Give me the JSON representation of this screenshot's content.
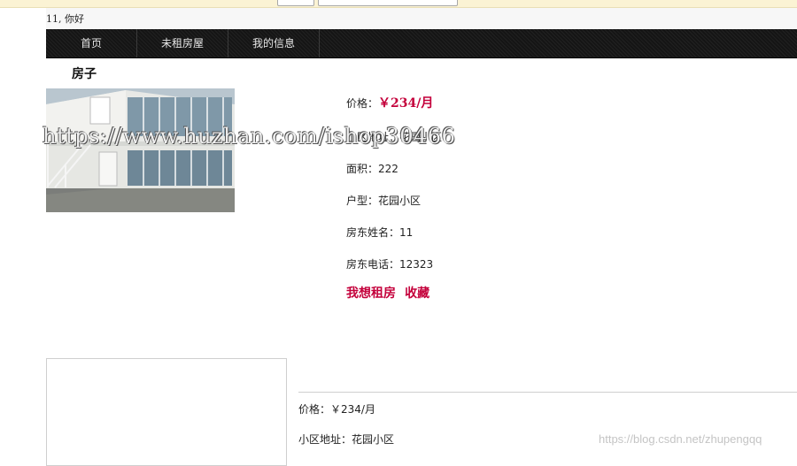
{
  "user": {
    "greeting": "11, 你好"
  },
  "nav": {
    "items": [
      {
        "label": "首页"
      },
      {
        "label": "未租房屋"
      },
      {
        "label": "我的信息"
      }
    ]
  },
  "house": {
    "section_title": "房子",
    "price_label": "价格：",
    "price_value": "￥234/月",
    "community_label": "小区地址：",
    "community_value": "花园小区",
    "area_label": "面积：",
    "area_value": "222",
    "type_label": "户型：",
    "type_value": "花园小区",
    "landlord_name_label": "房东姓名：",
    "landlord_name_value": "11",
    "landlord_phone_label": "房东电话：",
    "landlord_phone_value": "12323",
    "actions": {
      "rent": "我想租房",
      "favorite": "收藏"
    }
  },
  "listing2": {
    "price_label": "价格：",
    "price_value": "￥234/月",
    "community_label": "小区地址：",
    "community_value": "花园小区"
  },
  "watermarks": {
    "overlay": "https://www.huzhan.com/ishop30466",
    "corner": "https://blog.csdn.net/zhupengqq"
  },
  "colors": {
    "accent": "#c4003b",
    "nav_bg": "#151515",
    "nav_text": "#e6e6e6"
  }
}
